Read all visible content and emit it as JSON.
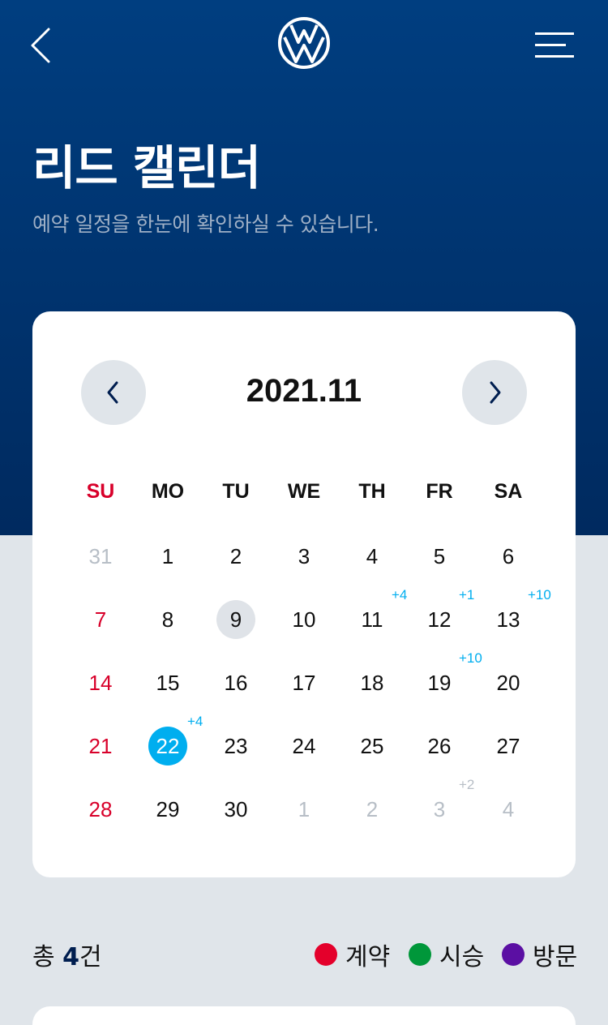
{
  "header": {
    "back_icon": "chevron-left-icon",
    "logo": "vw-logo",
    "menu_icon": "menu-icon"
  },
  "page": {
    "title": "리드 캘린더",
    "subtitle": "예약 일정을 한눈에 확인하실 수 있습니다."
  },
  "calendar": {
    "month": "2021.11",
    "prev_icon": "chevron-left-icon",
    "next_icon": "chevron-right-icon",
    "weekdays": [
      "SU",
      "MO",
      "TU",
      "WE",
      "TH",
      "FR",
      "SA"
    ],
    "weeks": [
      [
        {
          "d": "31",
          "muted": true
        },
        {
          "d": "1"
        },
        {
          "d": "2"
        },
        {
          "d": "3"
        },
        {
          "d": "4"
        },
        {
          "d": "5"
        },
        {
          "d": "6"
        }
      ],
      [
        {
          "d": "7"
        },
        {
          "d": "8"
        },
        {
          "d": "9",
          "today": true
        },
        {
          "d": "10"
        },
        {
          "d": "11",
          "badge": "+4"
        },
        {
          "d": "12",
          "badge": "+1"
        },
        {
          "d": "13",
          "badge": "+10"
        }
      ],
      [
        {
          "d": "14"
        },
        {
          "d": "15"
        },
        {
          "d": "16"
        },
        {
          "d": "17"
        },
        {
          "d": "18"
        },
        {
          "d": "19",
          "badge": "+10"
        },
        {
          "d": "20"
        }
      ],
      [
        {
          "d": "21"
        },
        {
          "d": "22",
          "selected": true,
          "badge": "+4"
        },
        {
          "d": "23"
        },
        {
          "d": "24"
        },
        {
          "d": "25"
        },
        {
          "d": "26"
        },
        {
          "d": "27"
        }
      ],
      [
        {
          "d": "28"
        },
        {
          "d": "29"
        },
        {
          "d": "30"
        },
        {
          "d": "1",
          "muted": true
        },
        {
          "d": "2",
          "muted": true
        },
        {
          "d": "3",
          "muted": true,
          "badge": "+2"
        },
        {
          "d": "4",
          "muted": true
        }
      ]
    ]
  },
  "summary": {
    "prefix": "총",
    "count": "4",
    "suffix": "건"
  },
  "legend": [
    {
      "label": "계약",
      "color": "#e4002b"
    },
    {
      "label": "시승",
      "color": "#00973a"
    },
    {
      "label": "방문",
      "color": "#5b0fa3"
    }
  ],
  "colors": {
    "brand_navy": "#001e50",
    "accent_blue": "#00aeef",
    "sunday_red": "#d8002a"
  }
}
